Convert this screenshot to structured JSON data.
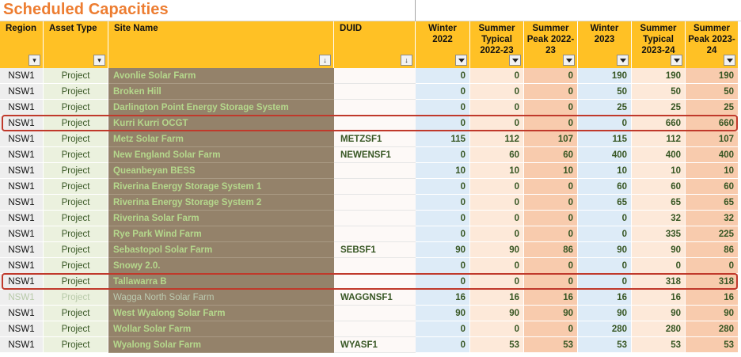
{
  "title": "Scheduled Capacities",
  "colors": {
    "title": "#ed7d31",
    "header": "#ffc125",
    "highlight": "#c0392b"
  },
  "headers": {
    "region": "Region",
    "asset_type": "Asset Type",
    "site_name": "Site Name",
    "duid": "DUID",
    "winter_2022": "Winter 2022",
    "summer_typical_2022": "Summer Typical 2022-23",
    "summer_peak_2022": "Summer Peak 2022-23",
    "winter_2023": "Winter 2023",
    "summer_typical_2023": "Summer Typical 2023-24",
    "summer_peak_2023": "Summer Peak 2023-24"
  },
  "filter_icons": {
    "region": "filter-active-icon",
    "asset_type": "filter-active-icon",
    "site_name": "sort-icon",
    "duid": "sort-icon",
    "others": "dropdown-arrow-icon"
  },
  "rows": [
    {
      "region": "NSW1",
      "type": "Project",
      "site": "Avonlie Solar Farm",
      "duid": "",
      "v": [
        "0",
        "0",
        "0",
        "190",
        "190",
        "190"
      ]
    },
    {
      "region": "NSW1",
      "type": "Project",
      "site": "Broken Hill",
      "duid": "",
      "v": [
        "0",
        "0",
        "0",
        "50",
        "50",
        "50"
      ]
    },
    {
      "region": "NSW1",
      "type": "Project",
      "site": "Darlington Point Energy Storage System",
      "duid": "",
      "v": [
        "0",
        "0",
        "0",
        "25",
        "25",
        "25"
      ]
    },
    {
      "region": "NSW1",
      "type": "Project",
      "site": "Kurri Kurri OCGT",
      "duid": "",
      "v": [
        "0",
        "0",
        "0",
        "0",
        "660",
        "660"
      ],
      "highlight": true
    },
    {
      "region": "NSW1",
      "type": "Project",
      "site": "Metz Solar Farm",
      "duid": "METZSF1",
      "v": [
        "115",
        "112",
        "107",
        "115",
        "112",
        "107"
      ]
    },
    {
      "region": "NSW1",
      "type": "Project",
      "site": "New England Solar Farm",
      "duid": "NEWENSF1",
      "v": [
        "0",
        "60",
        "60",
        "400",
        "400",
        "400"
      ]
    },
    {
      "region": "NSW1",
      "type": "Project",
      "site": "Queanbeyan BESS",
      "duid": "",
      "v": [
        "10",
        "10",
        "10",
        "10",
        "10",
        "10"
      ]
    },
    {
      "region": "NSW1",
      "type": "Project",
      "site": "Riverina Energy Storage System 1",
      "duid": "",
      "v": [
        "0",
        "0",
        "0",
        "60",
        "60",
        "60"
      ]
    },
    {
      "region": "NSW1",
      "type": "Project",
      "site": "Riverina Energy Storage System 2",
      "duid": "",
      "v": [
        "0",
        "0",
        "0",
        "65",
        "65",
        "65"
      ]
    },
    {
      "region": "NSW1",
      "type": "Project",
      "site": "Riverina Solar Farm",
      "duid": "",
      "v": [
        "0",
        "0",
        "0",
        "0",
        "32",
        "32"
      ]
    },
    {
      "region": "NSW1",
      "type": "Project",
      "site": "Rye Park Wind Farm",
      "duid": "",
      "v": [
        "0",
        "0",
        "0",
        "0",
        "335",
        "225"
      ]
    },
    {
      "region": "NSW1",
      "type": "Project",
      "site": "Sebastopol Solar Farm",
      "duid": "SEBSF1",
      "v": [
        "90",
        "90",
        "86",
        "90",
        "90",
        "86"
      ]
    },
    {
      "region": "NSW1",
      "type": "Project",
      "site": "Snowy 2.0.",
      "duid": "",
      "v": [
        "0",
        "0",
        "0",
        "0",
        "0",
        "0"
      ]
    },
    {
      "region": "NSW1",
      "type": "Project",
      "site": "Tallawarra B",
      "duid": "",
      "v": [
        "0",
        "0",
        "0",
        "0",
        "318",
        "318"
      ],
      "highlight": true
    },
    {
      "region": "NSW1",
      "type": "Project",
      "site": "Wagga North Solar Farm",
      "duid": "WAGGNSF1",
      "v": [
        "16",
        "16",
        "16",
        "16",
        "16",
        "16"
      ],
      "faded": true
    },
    {
      "region": "NSW1",
      "type": "Project",
      "site": "West Wyalong Solar Farm",
      "duid": "",
      "v": [
        "90",
        "90",
        "90",
        "90",
        "90",
        "90"
      ]
    },
    {
      "region": "NSW1",
      "type": "Project",
      "site": "Wollar Solar Farm",
      "duid": "",
      "v": [
        "0",
        "0",
        "0",
        "280",
        "280",
        "280"
      ]
    },
    {
      "region": "NSW1",
      "type": "Project",
      "site": "Wyalong Solar Farm",
      "duid": "WYASF1",
      "v": [
        "0",
        "53",
        "53",
        "53",
        "53",
        "53"
      ]
    }
  ]
}
